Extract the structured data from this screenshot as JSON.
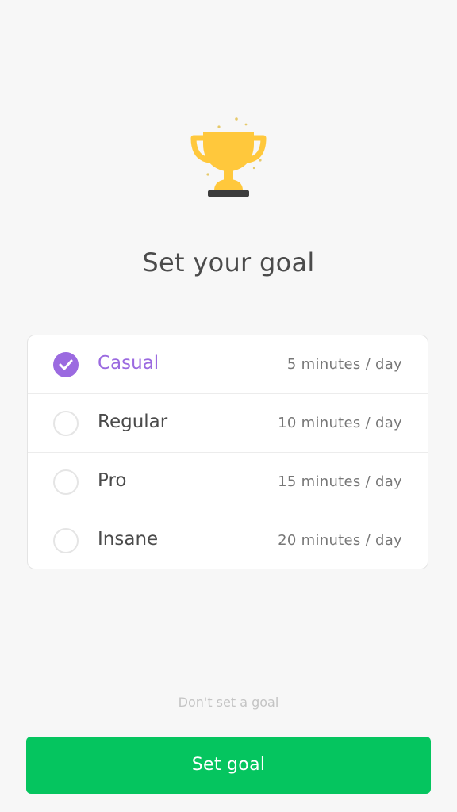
{
  "title": "Set your goal",
  "options": [
    {
      "name": "Casual",
      "time": "5 minutes / day",
      "selected": true
    },
    {
      "name": "Regular",
      "time": "10 minutes / day",
      "selected": false
    },
    {
      "name": "Pro",
      "time": "15 minutes / day",
      "selected": false
    },
    {
      "name": "Insane",
      "time": "20 minutes / day",
      "selected": false
    }
  ],
  "skip_label": "Don't set a goal",
  "cta_label": "Set goal",
  "colors": {
    "accent": "#9b6ae0",
    "cta": "#05c55f",
    "trophy": "#ffc83c",
    "trophy_base": "#3c3c3c"
  },
  "icons": {
    "trophy": "trophy-icon",
    "check": "check-icon"
  }
}
